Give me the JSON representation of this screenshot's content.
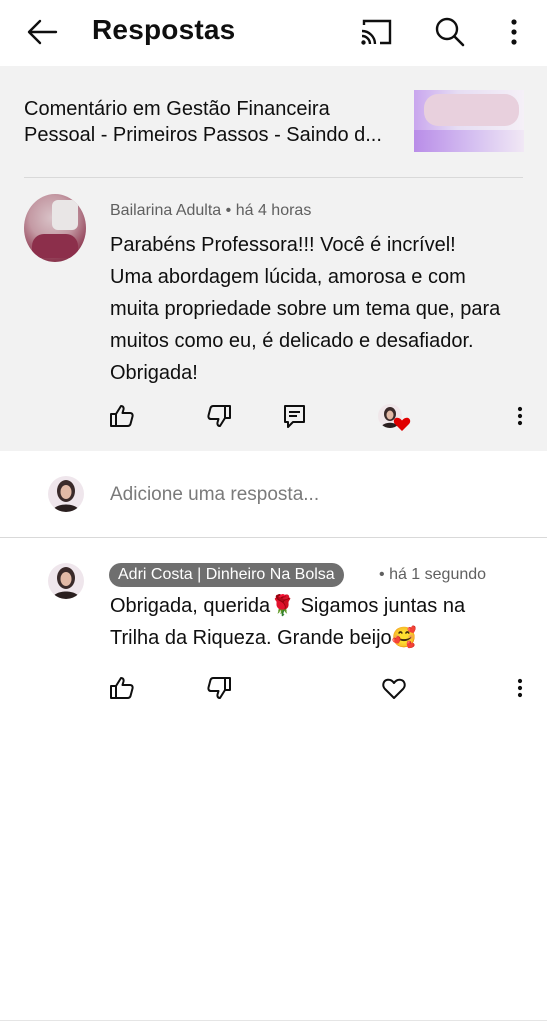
{
  "header": {
    "title": "Respostas",
    "back_icon": "back-arrow-icon",
    "cast_icon": "cast-icon",
    "search_icon": "search-icon",
    "more_icon": "more-vert-icon"
  },
  "video": {
    "line1": "Comentário em Gestão Financeira",
    "line2": "Pessoal - Primeiros Passos - Saindo d..."
  },
  "comment": {
    "author": "Bailarina Adulta",
    "separator": "•",
    "time": "há 4 horas",
    "lines": [
      "Parabéns Professora!!! Você é incrível!",
      "Uma abordagem lúcida, amorosa e com",
      "muita propriedade sobre um tema que, para",
      "muitos como eu, é delicado e desafiador.",
      "Obrigada!"
    ],
    "hearted_by_creator": true,
    "heart_color": "#e00000"
  },
  "reply_input": {
    "placeholder": "Adicione uma resposta..."
  },
  "reply": {
    "author": "Adri Costa | Dinheiro Na Bolsa",
    "separator": "•",
    "time": "há 1 segundo",
    "lines": [
      "Obrigada, querida🌹 Sigamos juntas na",
      "Trilha da Riqueza. Grande beijo🥰"
    ],
    "author_chip_color": "#6f6f6f"
  }
}
